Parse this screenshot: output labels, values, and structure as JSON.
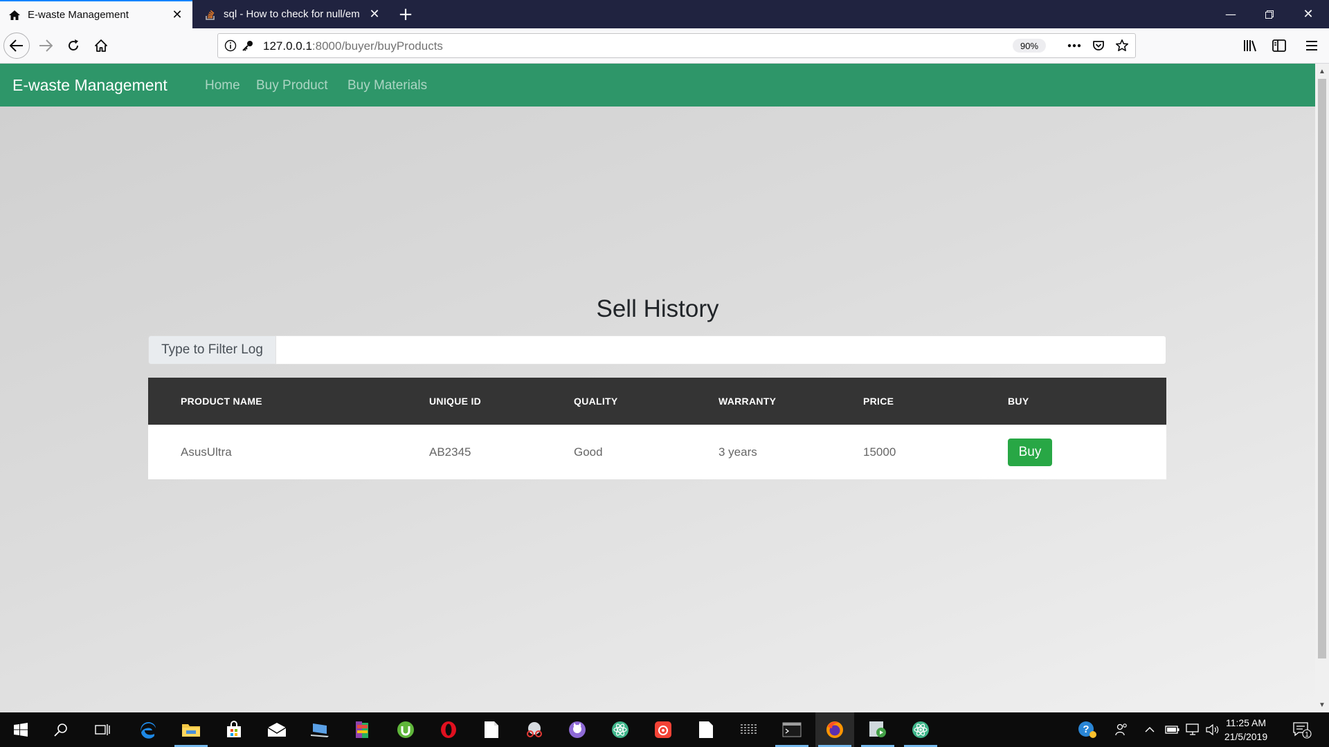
{
  "browser": {
    "tabs": [
      {
        "title": "E-waste Management",
        "active": true
      },
      {
        "title": "sql - How to check for null/em",
        "active": false
      }
    ],
    "url": {
      "host": "127.0.0.1",
      "rest": ":8000/buyer/buyProducts"
    },
    "zoom": "90%"
  },
  "site": {
    "brand": "E-waste Management",
    "nav": [
      "Home",
      "Buy Product",
      "Buy Materials"
    ],
    "nav_color": "#2e9669"
  },
  "page": {
    "title": "Sell History",
    "filter": {
      "label": "Type to Filter Log",
      "value": ""
    },
    "table": {
      "headers": [
        "PRODUCT NAME",
        "UNIQUE ID",
        "QUALITY",
        "WARRANTY",
        "PRICE",
        "BUY"
      ],
      "rows": [
        {
          "name": "AsusUltra",
          "uid": "AB2345",
          "quality": "Good",
          "warranty": "3 years",
          "price": "15000",
          "action": "Buy"
        }
      ]
    },
    "buy_color": "#28a745"
  },
  "taskbar": {
    "time": "11:25 AM",
    "date": "21/5/2019",
    "notifications": "1"
  }
}
